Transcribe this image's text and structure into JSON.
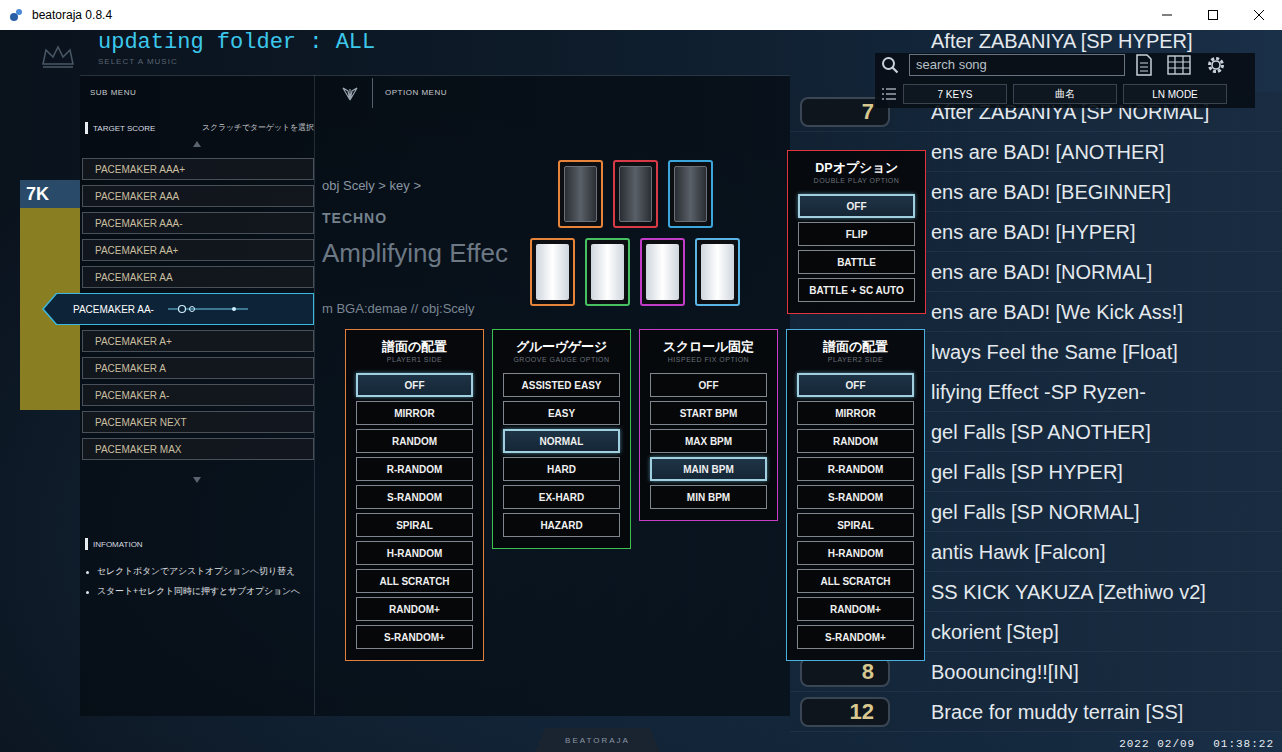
{
  "window": {
    "title": "beatoraja 0.8.4"
  },
  "status": {
    "text": "updating folder : ALL",
    "subtitle": "SELECT A MUSIC"
  },
  "mode_badge": {
    "label": "7K"
  },
  "song_info": {
    "path": "obj Scely > key >",
    "genre": "TECHNO",
    "title": "Amplifying Effec",
    "credit": "m BGA:demae // obj:Scely"
  },
  "sub_menu": {
    "label": "SUB MENU",
    "target_title": "TARGET SCORE",
    "target_hint": "スクラッチでターゲットを選択",
    "targets": [
      {
        "label": "PACEMAKER AAA+",
        "selected": false
      },
      {
        "label": "PACEMAKER AAA",
        "selected": false
      },
      {
        "label": "PACEMAKER AAA-",
        "selected": false
      },
      {
        "label": "PACEMAKER AA+",
        "selected": false
      },
      {
        "label": "PACEMAKER AA",
        "selected": false
      },
      {
        "label": "PACEMAKER AA-",
        "selected": true
      },
      {
        "label": "PACEMAKER A+",
        "selected": false
      },
      {
        "label": "PACEMAKER A",
        "selected": false
      },
      {
        "label": "PACEMAKER A-",
        "selected": false
      },
      {
        "label": "PACEMAKER NEXT",
        "selected": false
      },
      {
        "label": "PACEMAKER MAX",
        "selected": false
      }
    ],
    "info_title": "INFOMATION",
    "info_lines": [
      "セレクトボタンでアシストオプションへ切り替え",
      "スタート+セレクト同時に押すとサブオプションへ"
    ]
  },
  "option_menu": {
    "label": "OPTION MENU"
  },
  "keys": [
    {
      "kind": "black",
      "color": "#e8843a"
    },
    {
      "kind": "black",
      "color": "#d83a48"
    },
    {
      "kind": "black",
      "color": "#3aa6dc"
    },
    {
      "kind": "white",
      "color": "#e8843a"
    },
    {
      "kind": "white",
      "color": "#46c060"
    },
    {
      "kind": "white",
      "color": "#c23cc8"
    },
    {
      "kind": "white",
      "color": "#5ab4e4"
    }
  ],
  "dp_option": {
    "title": "DPオプション",
    "subtitle": "DOUBLE PLAY OPTION",
    "color": "#e0343c",
    "options": [
      {
        "label": "OFF",
        "selected": true
      },
      {
        "label": "FLIP",
        "selected": false
      },
      {
        "label": "BATTLE",
        "selected": false
      },
      {
        "label": "BATTLE + SC AUTO",
        "selected": false
      }
    ]
  },
  "panels": [
    {
      "title": "譜面の配置",
      "subtitle": "PLAYER1 SIDE",
      "color": "#e0803a",
      "options": [
        {
          "label": "OFF",
          "selected": true
        },
        {
          "label": "MIRROR",
          "selected": false
        },
        {
          "label": "RANDOM",
          "selected": false
        },
        {
          "label": "R-RANDOM",
          "selected": false
        },
        {
          "label": "S-RANDOM",
          "selected": false
        },
        {
          "label": "SPIRAL",
          "selected": false
        },
        {
          "label": "H-RANDOM",
          "selected": false
        },
        {
          "label": "ALL SCRATCH",
          "selected": false
        },
        {
          "label": "RANDOM+",
          "selected": false
        },
        {
          "label": "S-RANDOM+",
          "selected": false
        }
      ]
    },
    {
      "title": "グルーヴゲージ",
      "subtitle": "GROOVE GAUGE OPTION",
      "color": "#3cc050",
      "options": [
        {
          "label": "ASSISTED EASY",
          "selected": false
        },
        {
          "label": "EASY",
          "selected": false
        },
        {
          "label": "NORMAL",
          "selected": true
        },
        {
          "label": "HARD",
          "selected": false
        },
        {
          "label": "EX-HARD",
          "selected": false
        },
        {
          "label": "HAZARD",
          "selected": false
        }
      ]
    },
    {
      "title": "スクロール固定",
      "subtitle": "HISPEED FIX OPTION",
      "color": "#c83cc8",
      "options": [
        {
          "label": "OFF",
          "selected": false
        },
        {
          "label": "START BPM",
          "selected": false
        },
        {
          "label": "MAX BPM",
          "selected": false
        },
        {
          "label": "MAIN BPM",
          "selected": true
        },
        {
          "label": "MIN BPM",
          "selected": false
        }
      ]
    },
    {
      "title": "譜面の配置",
      "subtitle": "PLAYER2 SIDE",
      "color": "#4ab0e0",
      "options": [
        {
          "label": "OFF",
          "selected": true
        },
        {
          "label": "MIRROR",
          "selected": false
        },
        {
          "label": "RANDOM",
          "selected": false
        },
        {
          "label": "R-RANDOM",
          "selected": false
        },
        {
          "label": "S-RANDOM",
          "selected": false
        },
        {
          "label": "SPIRAL",
          "selected": false
        },
        {
          "label": "H-RANDOM",
          "selected": false
        },
        {
          "label": "ALL SCRATCH",
          "selected": false
        },
        {
          "label": "RANDOM+",
          "selected": false
        },
        {
          "label": "S-RANDOM+",
          "selected": false
        }
      ]
    }
  ],
  "search": {
    "placeholder": "search song"
  },
  "sort_tabs": [
    {
      "label": "7 KEYS"
    },
    {
      "label": "曲名"
    },
    {
      "label": "LN MODE"
    }
  ],
  "top_song": {
    "title": "After ZABANIYA [SP HYPER]"
  },
  "songs": [
    {
      "title": "After ZABANIYA [SP NORMAL]",
      "level": "7"
    },
    {
      "title": "ens are BAD! [ANOTHER]"
    },
    {
      "title": "ens are BAD! [BEGINNER]"
    },
    {
      "title": "ens are BAD! [HYPER]"
    },
    {
      "title": "ens are BAD! [NORMAL]"
    },
    {
      "title": "ens are BAD! [We Kick Ass!]"
    },
    {
      "title": "lways Feel the Same [Float]"
    },
    {
      "title": "lifying Effect -SP Ryzen-"
    },
    {
      "title": "gel Falls [SP ANOTHER]"
    },
    {
      "title": "gel Falls [SP HYPER]"
    },
    {
      "title": "gel Falls [SP NORMAL]"
    },
    {
      "title": "antis Hawk [Falcon]"
    },
    {
      "title": "SS KICK YAKUZA [Zethiwo v2]"
    },
    {
      "title": "ckorient [Step]"
    },
    {
      "title": "Booouncing!![IN]",
      "level": "8"
    },
    {
      "title": "Brace for muddy terrain [SS]",
      "level": "12"
    }
  ],
  "footer": {
    "brand": "BEATORAJA",
    "date": "2022 02/09",
    "time": "01:38:22"
  }
}
